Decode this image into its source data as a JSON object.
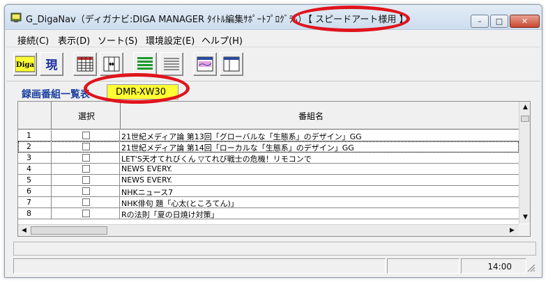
{
  "window": {
    "title": "G_DigaNav（ディガナビ:DIGA MANAGER ﾀｲﾄﾙ編集ｻﾎﾟｰﾄﾌﾟﾛｸﾞﾗﾑ）",
    "title_highlight": "【 スピードアート様用 】",
    "controls": {
      "minimize": "–",
      "maximize": "□",
      "close": "✕"
    }
  },
  "menu": [
    {
      "label": "接続(C)"
    },
    {
      "label": "表示(D)"
    },
    {
      "label": "ソート(S)"
    },
    {
      "label": "環境設定(E)"
    },
    {
      "label": "ヘルプ(H)"
    }
  ],
  "toolbar": {
    "diga_label": "Diga",
    "current_label": "現",
    "icons": [
      "diga-icon",
      "current-icon",
      "grid-table-icon",
      "column-width-icon",
      "list-green-icon",
      "list-lines-icon",
      "preview-icon",
      "split-view-icon"
    ]
  },
  "section": {
    "label": "録画番組一覧表",
    "model": "DMR-XW30"
  },
  "table": {
    "headers": {
      "num": "",
      "select": "選択",
      "name": "番組名"
    },
    "rows": [
      {
        "num": "1",
        "name": "21世紀メディア論 第13回「グローバルな「生態系」のデザイン」GG"
      },
      {
        "num": "2",
        "name": "21世紀メディア論 第14回「ローカルな「生態系」のデザイン」GG"
      },
      {
        "num": "3",
        "name": "LET'S天才てれびくん ▽てれび戦士の危機！リモコンで"
      },
      {
        "num": "4",
        "name": "NEWS EVERY."
      },
      {
        "num": "5",
        "name": "NEWS EVERY."
      },
      {
        "num": "6",
        "name": "NHKニュース7"
      },
      {
        "num": "7",
        "name": "NHK俳句 題「心太(ところてん)」"
      },
      {
        "num": "8",
        "name": "Rの法則「夏の日焼け対策」"
      }
    ]
  },
  "status": {
    "time": "14:00"
  },
  "annotations": {
    "color": "#e0141c"
  }
}
